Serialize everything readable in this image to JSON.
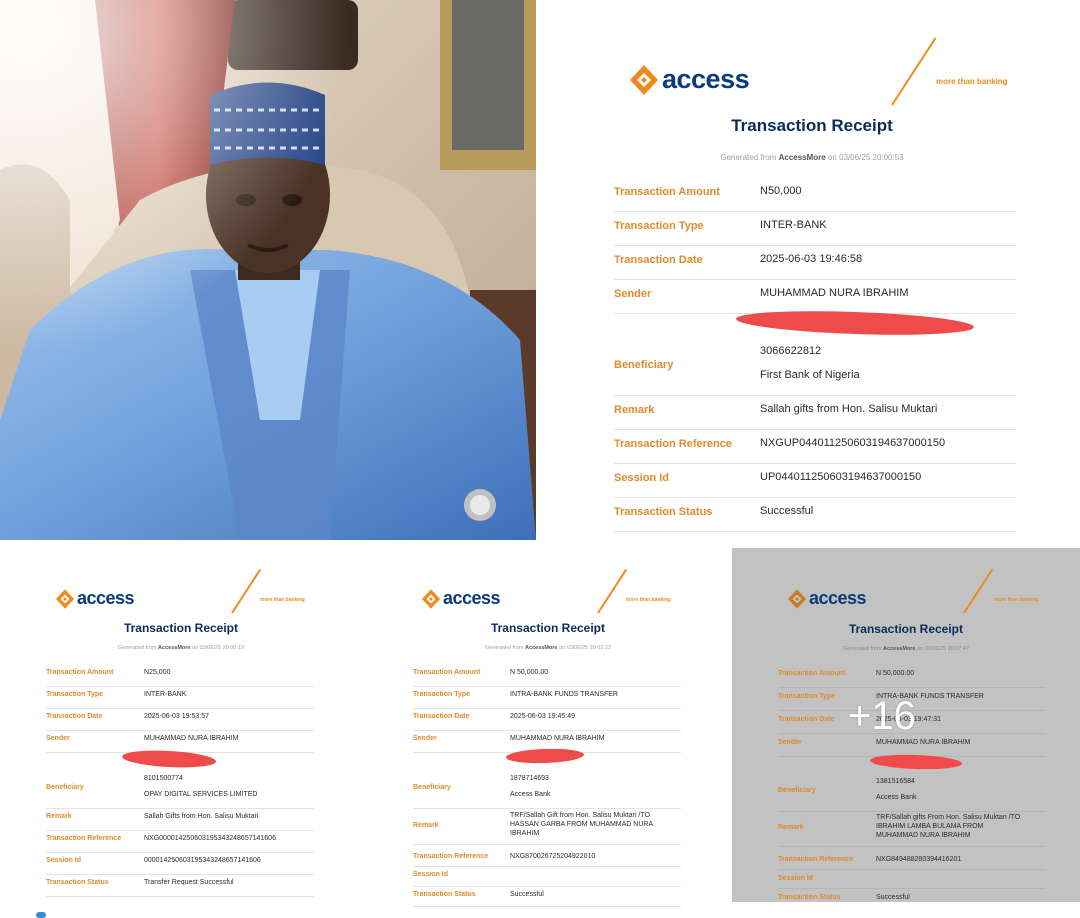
{
  "collage": {
    "more_count": "+16"
  },
  "brand": {
    "name": "access",
    "tagline": "more than banking",
    "title": "Transaction Receipt",
    "gen_prefix": "Generated from",
    "gen_app": "AccessMore",
    "gen_on": "on"
  },
  "receipts": [
    {
      "generated": "03/06/25 20:00:53",
      "rows": [
        {
          "label": "Transaction Amount",
          "value": "N50,000"
        },
        {
          "label": "Transaction Type",
          "value": "INTER-BANK"
        },
        {
          "label": "Transaction Date",
          "value": "2025-06-03 19:46:58"
        },
        {
          "label": "Sender",
          "value": "MUHAMMAD NURA IBRAHIM"
        },
        {
          "label": "Beneficiary",
          "value": "3066622812",
          "value2": "First Bank of Nigeria"
        },
        {
          "label": "Remark",
          "value": "Sallah gifts from Hon. Salisu Muktari"
        },
        {
          "label": "Transaction Reference",
          "value": "NXGUP04401125060319463700015​0"
        },
        {
          "label": "Session Id",
          "value": "UP044011250603194637000150"
        },
        {
          "label": "Transaction Status",
          "value": "Successful"
        }
      ]
    },
    {
      "generated": "03/06/25 20:00:19",
      "rows": [
        {
          "label": "Transaction Amount",
          "value": "N25,000"
        },
        {
          "label": "Transaction Type",
          "value": "INTER-BANK"
        },
        {
          "label": "Transaction Date",
          "value": "2025-06-03 19:53:57"
        },
        {
          "label": "Sender",
          "value": "MUHAMMAD NURA IBRAHIM"
        },
        {
          "label": "Beneficiary",
          "value": "8101500774",
          "value2": "OPAY DIGITAL SERVICES LIMITED"
        },
        {
          "label": "Remark",
          "value": "Sallah Gifts from Hon. Salisu Muktari"
        },
        {
          "label": "Transaction Reference",
          "value": "NXG000014250603195343248657141606"
        },
        {
          "label": "Session Id",
          "value": "000014250603195343248657141606"
        },
        {
          "label": "Transaction Status",
          "value": "Transfer Request Successful"
        }
      ]
    },
    {
      "generated": "03/06/25 20:02:22",
      "rows": [
        {
          "label": "Transaction Amount",
          "value": "N 50,000.00"
        },
        {
          "label": "Transaction Type",
          "value": "INTRA-BANK FUNDS TRANSFER"
        },
        {
          "label": "Transaction Date",
          "value": "2025-06-03 19:45:49"
        },
        {
          "label": "Sender",
          "value": "MUHAMMAD NURA IBRAHIM"
        },
        {
          "label": "Beneficiary",
          "value": "1878714693",
          "value2": "Access Bank"
        },
        {
          "label": "Remark",
          "value": "TRF/Sallah Gift from Hon. Salisu Muktari /TO HASSAN GARBA FROM MUHAMMAD NURA IBRAHIM"
        },
        {
          "label": "Transaction Reference",
          "value": "NXG870026725204922010"
        },
        {
          "label": "Session Id",
          "value": ""
        },
        {
          "label": "Transaction Status",
          "value": "Successful"
        }
      ]
    },
    {
      "generated": "03/06/25 20:07:47",
      "rows": [
        {
          "label": "Transaction Amount",
          "value": "N 50,000.00"
        },
        {
          "label": "Transaction Type",
          "value": "INTRA-BANK FUNDS TRANSFER"
        },
        {
          "label": "Transaction Date",
          "value": "2025-06-03 19:47:31"
        },
        {
          "label": "Sender",
          "value": "MUHAMMAD NURA IBRAHIM"
        },
        {
          "label": "Beneficiary",
          "value": "1381516584",
          "value2": "Access Bank"
        },
        {
          "label": "Remark",
          "value": "TRF/Sallah gifts From Hon. Salisu Muktari /TO IBRAHIM LAMBA BULAMA FROM MUHAMMAD NURA IBRAHIM"
        },
        {
          "label": "Transaction Reference",
          "value": "NXG84948828039441620​1"
        },
        {
          "label": "Session Id",
          "value": ""
        },
        {
          "label": "Transaction Status",
          "value": "Successful"
        }
      ]
    }
  ]
}
